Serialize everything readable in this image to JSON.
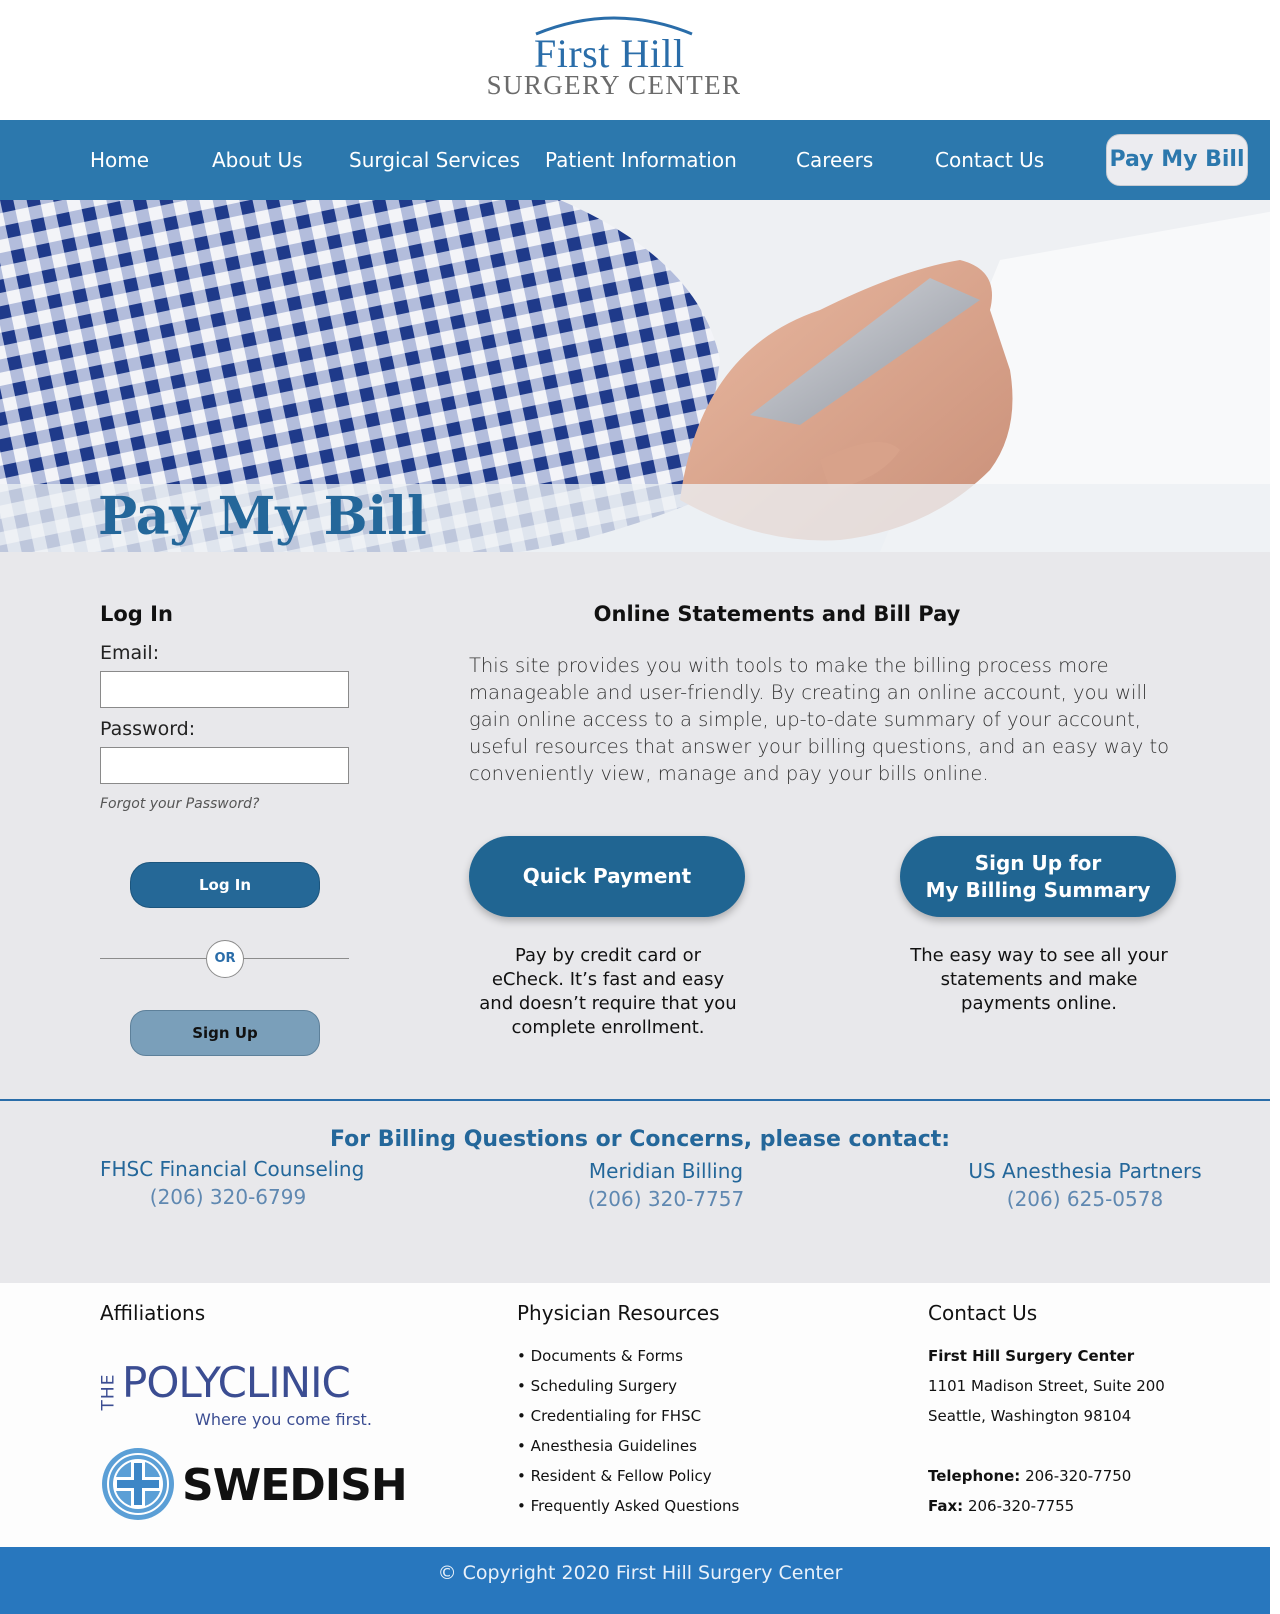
{
  "logo": {
    "line1": "First Hill",
    "line2": "SURGERY CENTER"
  },
  "nav": {
    "items": [
      "Home",
      "About Us",
      "Surgical Services",
      "Patient Information",
      "Careers",
      "Contact Us"
    ],
    "pay_label": "Pay My Bill"
  },
  "hero": {
    "title": "Pay My Bill"
  },
  "login": {
    "title": "Log In",
    "email_label": "Email:",
    "email_value": "",
    "password_label": "Password:",
    "password_value": "",
    "forgot": "Forgot your Password?",
    "login_button": "Log In",
    "or": "OR",
    "signup_button": "Sign Up"
  },
  "online": {
    "title": "Online Statements and Bill Pay",
    "description": "This site provides you with tools to make the billing process more manageable and user-friendly. By creating an online account, you will gain online access to a simple, up-to-date summary of your account, useful resources that answer your billing questions, and an easy way to conveniently view, manage and pay your bills online.",
    "quick_button": "Quick Payment",
    "quick_desc": "Pay by credit card or eCheck. It’s fast and easy and doesn’t require that you complete enrollment.",
    "signup_line1": "Sign Up for",
    "signup_line2": "My Billing Summary",
    "signup_desc": "The easy way to see all your statements and make payments online."
  },
  "billing": {
    "title": "For Billing Questions or Concerns, please contact:",
    "contacts": [
      {
        "name": "FHSC Financial Counseling",
        "phone": "(206) 320-6799"
      },
      {
        "name": "Meridian Billing",
        "phone": "(206) 320-7757"
      },
      {
        "name": "US Anesthesia Partners",
        "phone": "(206) 625-0578"
      }
    ]
  },
  "footer": {
    "affiliations_title": "Affiliations",
    "polyclinic": {
      "the": "THE",
      "name": "POLYCLINIC",
      "tagline": "Where you come first."
    },
    "swedish": "SWEDISH",
    "resources_title": "Physician Resources",
    "resources": [
      "• Documents & Forms",
      "• Scheduling Surgery",
      "• Credentialing for FHSC",
      "• Anesthesia Guidelines",
      "• Resident & Fellow Policy",
      "• Frequently Asked Questions"
    ],
    "contact_title": "Contact Us",
    "contact_name": "First Hill Surgery Center",
    "address1": "1101 Madison Street, Suite 200",
    "address2": "Seattle, Washington 98104",
    "telephone_label": "Telephone:",
    "telephone": "206-320-7750",
    "fax_label": "Fax:",
    "fax": "206-320-7755"
  },
  "copyright": "© Copyright 2020 First Hill Surgery Center",
  "colors": {
    "brand_blue": "#2c78ad",
    "dark_blue": "#206592",
    "light_gray": "#e8e8eb",
    "footer_blue": "#2877be"
  }
}
